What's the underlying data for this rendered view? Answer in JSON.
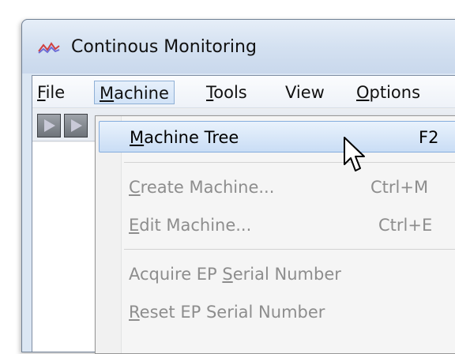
{
  "window": {
    "title": "Continous Monitoring",
    "icon": "chart-line-icon"
  },
  "menubar": {
    "items": [
      {
        "label_parts": [
          "",
          "F",
          "ile"
        ]
      },
      {
        "label_parts": [
          "",
          "M",
          "achine"
        ]
      },
      {
        "label_parts": [
          "",
          "T",
          "ools"
        ]
      },
      {
        "label_parts": [
          "View",
          "",
          ""
        ]
      },
      {
        "label_parts": [
          "",
          "O",
          "ptions"
        ]
      }
    ]
  },
  "dropdown": {
    "items": [
      {
        "pre": "",
        "ul": "M",
        "post": "achine Tree",
        "shortcut": "F2",
        "state": "highlighted"
      },
      {
        "pre": "",
        "ul": "C",
        "post": "reate Machine...",
        "shortcut": "Ctrl+M",
        "state": "disabled"
      },
      {
        "pre": "",
        "ul": "E",
        "post": "dit Machine...",
        "shortcut": "Ctrl+E",
        "state": "disabled"
      },
      {
        "pre": "Acquire EP ",
        "ul": "S",
        "post": "erial Number",
        "shortcut": "",
        "state": "disabled"
      },
      {
        "pre": "",
        "ul": "R",
        "post": "eset EP Serial Number",
        "shortcut": "",
        "state": "disabled"
      }
    ]
  },
  "colors": {
    "highlight": "#c9ddf5",
    "disabled_text": "#8d8d8d",
    "titlebar": "#d4e1f1"
  }
}
